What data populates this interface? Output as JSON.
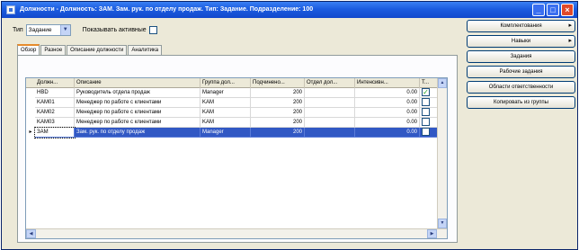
{
  "window": {
    "title": "Должности - Должность: ЗАМ. Зам. рук. по отделу продаж. Тип: Задание. Подразделение: 100",
    "buttons": {
      "minimize": "_",
      "maximize": "□",
      "close": "×"
    }
  },
  "filter": {
    "type_label": "Тип",
    "type_value": "Задание",
    "show_active_label": "Показывать активные",
    "show_active_checked": false
  },
  "tabs": [
    {
      "label": "Обзор",
      "active": true
    },
    {
      "label": "Разное",
      "active": false
    },
    {
      "label": "Описание должности",
      "active": false
    },
    {
      "label": "Аналитика",
      "active": false
    }
  ],
  "grid": {
    "columns": [
      "Должн...",
      "Описание",
      "Группа дол...",
      "Подчинено...",
      "Отдел дол...",
      "Интенсивн...",
      "Т..."
    ],
    "rows": [
      {
        "code": "HBD",
        "description": "Руководитель отдела продаж",
        "group": "Manager",
        "sub": "200",
        "dept": "",
        "intensity": "0.00",
        "flag": true,
        "selected": false
      },
      {
        "code": "KAM01",
        "description": "Менеджер по работе с клиентами",
        "group": "KAM",
        "sub": "200",
        "dept": "",
        "intensity": "0.00",
        "flag": false,
        "selected": false
      },
      {
        "code": "KAM02",
        "description": "Менеджер по работе с клиентами",
        "group": "KAM",
        "sub": "200",
        "dept": "",
        "intensity": "0.00",
        "flag": false,
        "selected": false
      },
      {
        "code": "KAM03",
        "description": "Менеджер по работе с клиентами",
        "group": "KAM",
        "sub": "200",
        "dept": "",
        "intensity": "0.00",
        "flag": false,
        "selected": false
      },
      {
        "code": "ЗАМ",
        "description": "Зам. рук. по отделу продаж",
        "group": "Manager",
        "sub": "200",
        "dept": "",
        "intensity": "0.00",
        "flag": false,
        "selected": true
      }
    ]
  },
  "side_buttons": [
    {
      "label": "Комплектования",
      "caret": true
    },
    {
      "label": "Навыки",
      "caret": true
    },
    {
      "label": "Задания",
      "caret": false
    },
    {
      "label": "Рабочие задания",
      "caret": false
    },
    {
      "label": "Области ответственности",
      "caret": false
    },
    {
      "label": "Копировать из группы",
      "caret": false
    }
  ],
  "colors": {
    "title_bar": "#1b5ce0",
    "selection": "#3158c4",
    "tab_accent": "#e68b2c"
  }
}
